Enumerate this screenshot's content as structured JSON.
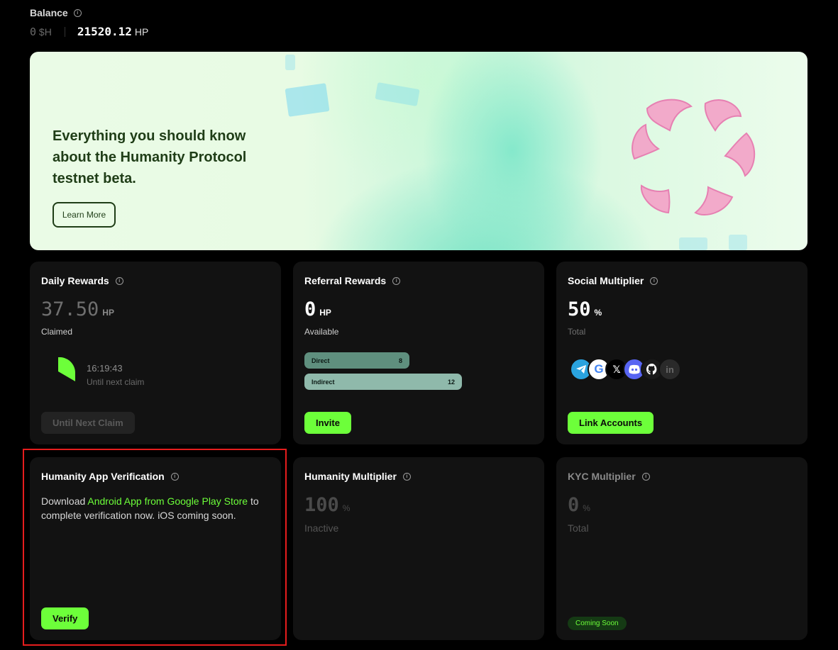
{
  "balance": {
    "title": "Balance",
    "sh_value": "0",
    "sh_unit": "$H",
    "hp_value": "21520.12",
    "hp_unit": "HP"
  },
  "banner": {
    "headline": "Everything you should know about the Humanity Protocol testnet beta.",
    "cta_label": "Learn More"
  },
  "daily_rewards": {
    "title": "Daily Rewards",
    "value": "37.50",
    "unit": "HP",
    "status": "Claimed",
    "countdown": "16:19:43",
    "countdown_label": "Until next claim",
    "button_label": "Until Next Claim"
  },
  "referral_rewards": {
    "title": "Referral Rewards",
    "value": "0",
    "unit": "HP",
    "status": "Available",
    "direct_label": "Direct",
    "direct_count": "8",
    "indirect_label": "Indirect",
    "indirect_count": "12",
    "button_label": "Invite"
  },
  "social_multiplier": {
    "title": "Social Multiplier",
    "value": "50",
    "unit": "%",
    "status": "Total",
    "icons": [
      "telegram-icon",
      "google-icon",
      "x-icon",
      "discord-icon",
      "github-icon",
      "linkedin-icon"
    ],
    "button_label": "Link Accounts"
  },
  "app_verification": {
    "title": "Humanity App Verification",
    "text_before": "Download ",
    "link_text": "Android App from Google Play Store",
    "text_after": " to complete verification now. iOS coming soon.",
    "button_label": "Verify"
  },
  "humanity_multiplier": {
    "title": "Humanity Multiplier",
    "value": "100",
    "unit": "%",
    "status": "Inactive"
  },
  "kyc_multiplier": {
    "title": "KYC Multiplier",
    "value": "0",
    "unit": "%",
    "status": "Total",
    "badge": "Coming Soon"
  },
  "colors": {
    "accent": "#6dff3a",
    "card_bg": "#121212",
    "page_bg": "#000000",
    "highlight": "#e51d1d"
  }
}
